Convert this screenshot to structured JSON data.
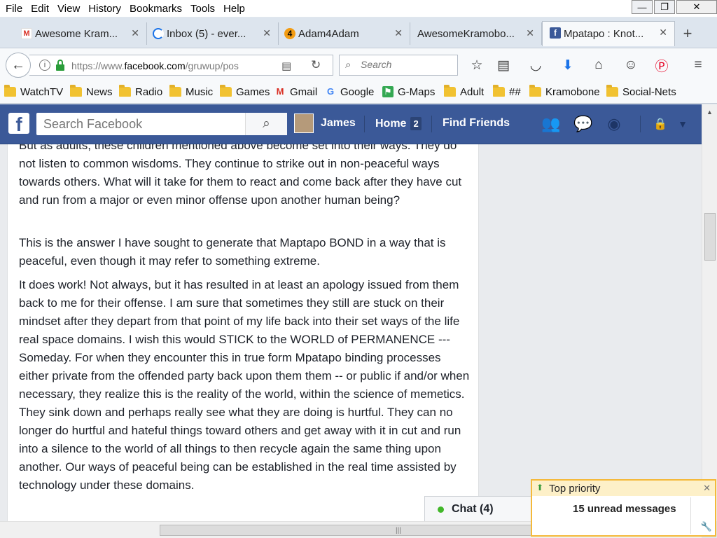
{
  "menu": [
    "File",
    "Edit",
    "View",
    "History",
    "Bookmarks",
    "Tools",
    "Help"
  ],
  "window_controls": {
    "minimize": "—",
    "restore": "❐",
    "close": "✕"
  },
  "tabs": [
    {
      "label": "Awesome Kram...",
      "icon": "gmail-icon"
    },
    {
      "label": "Inbox (5) - ever...",
      "icon": "inbox-icon"
    },
    {
      "label": "Adam4Adam",
      "icon": "adam4adam-icon"
    },
    {
      "label": "AwesomeKramobo...",
      "icon": ""
    },
    {
      "label": "Mpatapo : Knot...",
      "icon": "facebook-icon",
      "active": true
    }
  ],
  "new_tab": "+",
  "address": {
    "prefix": "https://www.",
    "domain": "facebook.com",
    "path": "/gruwup/pos"
  },
  "search": {
    "placeholder": "Search"
  },
  "bookmarks": [
    "WatchTV",
    "News",
    "Radio",
    "Music",
    "Games",
    "Gmail",
    "Google",
    "G-Maps",
    "Adult",
    "##",
    "Kramobone",
    "Social-Nets"
  ],
  "facebook": {
    "search_placeholder": "Search Facebook",
    "user": "James",
    "home": "Home",
    "home_count": "2",
    "find_friends": "Find Friends"
  },
  "post": {
    "paragraphs": [
      "But as adults, these children mentioned above become set into their ways. They do not listen to common wisdoms. They continue to strike out in non-peaceful ways towards others. What will it take for them to react and come back after they have cut and run from a major or even minor offense upon another human being?",
      "This is the answer I have sought to generate that Maptapo BOND in a way that is peaceful, even though it may refer to something extreme.",
      "It does work! Not always, but it has resulted in at least an apology issued from them back to me for their offense. I am sure that sometimes they still are stuck on their mindset after they depart from that point of my life back into their set ways of the life real space domains. I wish this would STICK to the WORLD of PERMANENCE --- Someday. For when they encounter this in true form Mpatapo binding processes either private from the offended party back upon them them -- or public if and/or when necessary, they realize this is the reality of the world, within the science of memetics. They sink down and perhaps really see what they are doing is hurtful. They can no longer do hurtful and hateful things toward others and get away with it in cut and run into a silence to the world of all things to then recycle again the same thing upon another. Our ways of peaceful being can be established in the real time assisted by technology under these domains."
    ]
  },
  "chat": {
    "label": "Chat (4)"
  },
  "notification": {
    "title": "Top priority",
    "message": "15 unread messages",
    "close": "✕"
  },
  "colors": {
    "facebook_blue": "#3b5998",
    "notification_border": "#f4b93a",
    "chat_online": "#42b72a"
  }
}
